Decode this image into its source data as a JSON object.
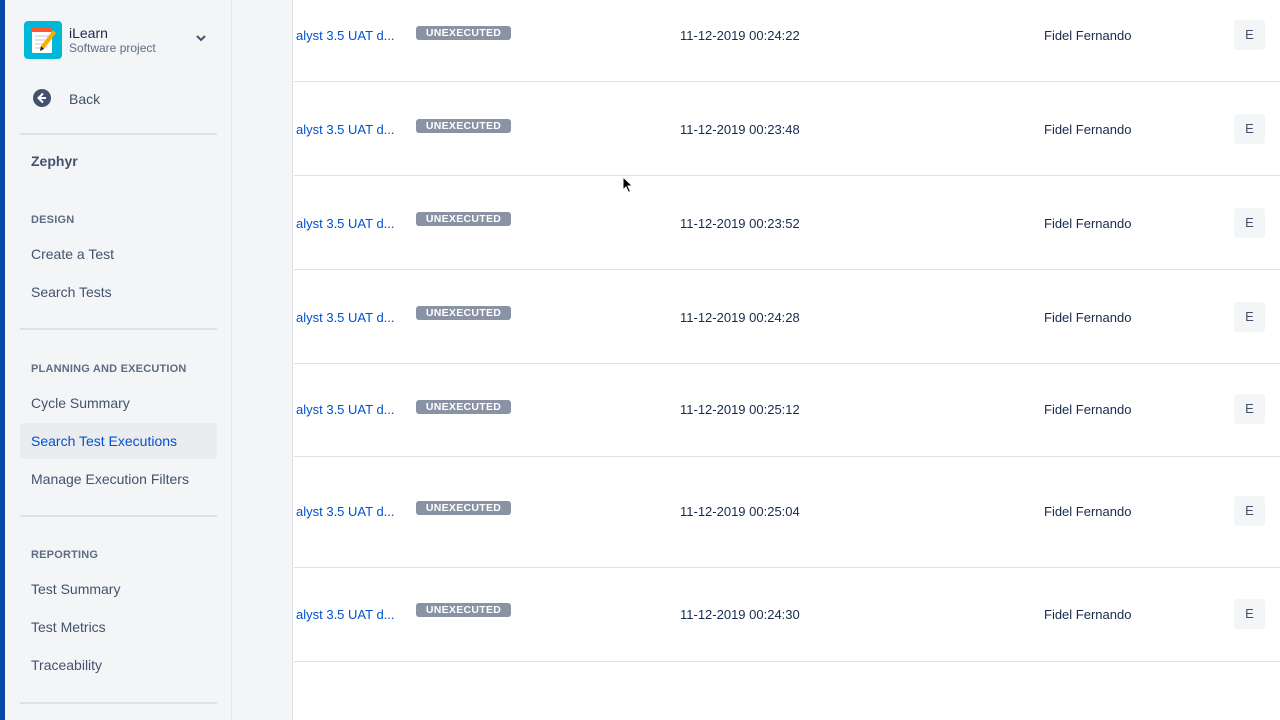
{
  "project": {
    "name": "iLearn",
    "type": "Software project"
  },
  "nav": {
    "back_label": "Back",
    "app_name": "Zephyr",
    "sections": {
      "design": "DESIGN",
      "planning": "PLANNING AND EXECUTION",
      "reporting": "REPORTING"
    },
    "items": {
      "create_test": "Create a Test",
      "search_tests": "Search Tests",
      "cycle_summary": "Cycle Summary",
      "search_executions": "Search Test Executions",
      "manage_filters": "Manage Execution Filters",
      "test_summary": "Test Summary",
      "test_metrics": "Test Metrics",
      "traceability": "Traceability"
    }
  },
  "executions": [
    {
      "issue": "alyst 3.5 UAT d...",
      "status": "UNEXECUTED",
      "executed_on": "11-12-2019 00:24:22",
      "user": "Fidel Fernando",
      "action": "E"
    },
    {
      "issue": "alyst 3.5 UAT d...",
      "status": "UNEXECUTED",
      "executed_on": "11-12-2019 00:23:48",
      "user": "Fidel Fernando",
      "action": "E"
    },
    {
      "issue": "alyst 3.5 UAT d...",
      "status": "UNEXECUTED",
      "executed_on": "11-12-2019 00:23:52",
      "user": "Fidel Fernando",
      "action": "E"
    },
    {
      "issue": "alyst 3.5 UAT d...",
      "status": "UNEXECUTED",
      "executed_on": "11-12-2019 00:24:28",
      "user": "Fidel Fernando",
      "action": "E"
    },
    {
      "issue": "alyst 3.5 UAT d...",
      "status": "UNEXECUTED",
      "executed_on": "11-12-2019 00:25:12",
      "user": "Fidel Fernando",
      "action": "E"
    },
    {
      "issue": "alyst 3.5 UAT d...",
      "status": "UNEXECUTED",
      "executed_on": "11-12-2019 00:25:04",
      "user": "Fidel Fernando",
      "action": "E"
    },
    {
      "issue": "alyst 3.5 UAT d...",
      "status": "UNEXECUTED",
      "executed_on": "11-12-2019 00:24:30",
      "user": "Fidel Fernando",
      "action": "E"
    }
  ],
  "colors": {
    "brand": "#0747a6",
    "link": "#0052cc",
    "status_unexecuted": "#8993a4",
    "sidebar_bg": "#f4f5f7"
  },
  "icons": {
    "project_logo": "notepad-pencil-icon",
    "project_switcher": "chevron-down-icon",
    "back": "arrow-left-circle-icon",
    "cursor": "mouse-pointer-icon"
  }
}
